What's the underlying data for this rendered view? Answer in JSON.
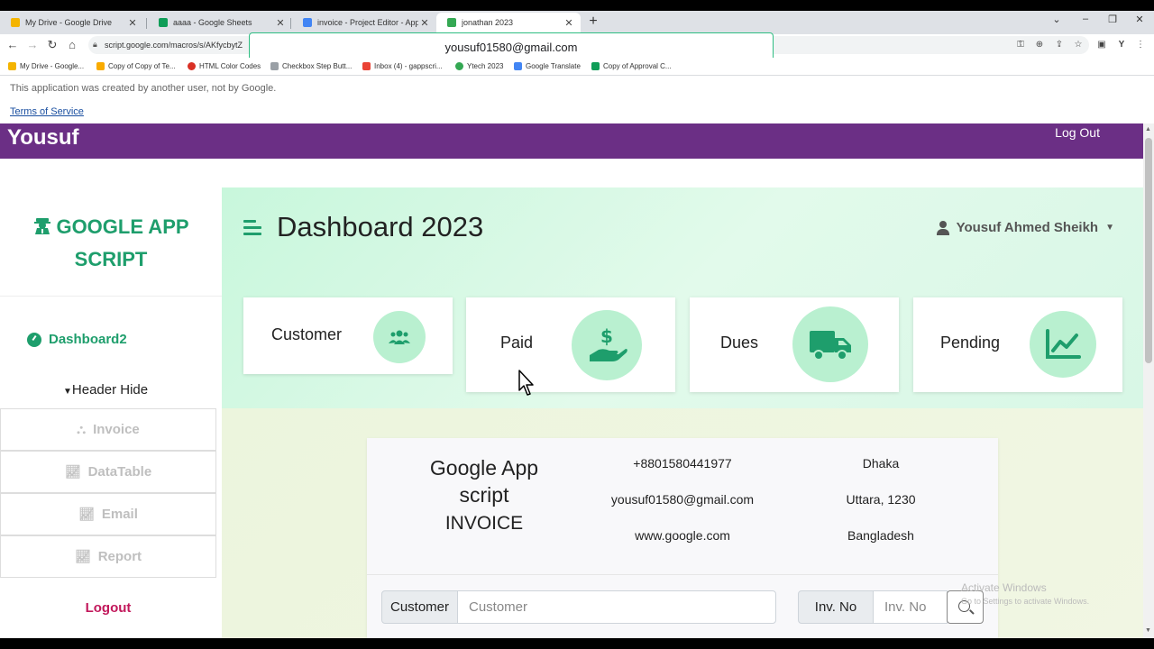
{
  "browser": {
    "tabs": [
      {
        "title": "My Drive - Google Drive",
        "favicon_color": "#f4b400"
      },
      {
        "title": "aaaa - Google Sheets",
        "favicon_color": "#0f9d58"
      },
      {
        "title": "invoice - Project Editor - Apps Sc",
        "favicon_color": "#4285f4"
      },
      {
        "title": "jonathan 2023",
        "favicon_color": "#34a853"
      }
    ],
    "url": "script.google.com/macros/s/AKfycbytZ",
    "autofill_suggestion": "yousuf01580@gmail.com",
    "bookmarks": [
      {
        "label": "My Drive - Google...",
        "color": "#f4b400"
      },
      {
        "label": "Copy of Copy of Te...",
        "color": "#f9ab00"
      },
      {
        "label": "HTML Color Codes",
        "color": "#d93025"
      },
      {
        "label": "Checkbox Step Butt...",
        "color": "#9aa0a6"
      },
      {
        "label": "Inbox (4) - gappscri...",
        "color": "#ea4335"
      },
      {
        "label": "Ytech 2023",
        "color": "#34a853"
      },
      {
        "label": "Google Translate",
        "color": "#4285f4"
      },
      {
        "label": "Copy of Approval C...",
        "color": "#0f9d58"
      }
    ]
  },
  "page": {
    "notice": "This application was created by another user, not by Google.",
    "terms": "Terms of Service"
  },
  "topbar": {
    "brand": "Yousuf",
    "logout": "Log Out"
  },
  "sidebar": {
    "logo": "GOOGLE APP SCRIPT",
    "dashboard": "Dashboard2",
    "header_hide": "Header Hide",
    "menu": [
      {
        "label": "Invoice",
        "icon": "share-nodes-icon"
      },
      {
        "label": "DataTable",
        "icon": "line-chart-icon"
      },
      {
        "label": "Email",
        "icon": "line-chart-icon"
      },
      {
        "label": "Report",
        "icon": "line-chart-icon"
      }
    ],
    "logout": "Logout"
  },
  "header": {
    "title": "Dashboard 2023",
    "user": "Yousuf Ahmed Sheikh"
  },
  "cards": [
    {
      "label": "Customer",
      "icon": "users-icon"
    },
    {
      "label": "Paid",
      "icon": "hand-dollar-icon"
    },
    {
      "label": "Dues",
      "icon": "truck-icon"
    },
    {
      "label": "Pending",
      "icon": "chart-line-icon"
    }
  ],
  "invoice": {
    "company_line1": "Google App",
    "company_line2": "script",
    "title": "INVOICE",
    "contact": [
      "+8801580441977",
      "yousuf01580@gmail.com",
      "www.google.com"
    ],
    "address": [
      "Dhaka",
      "Uttara, 1230",
      "Bangladesh"
    ],
    "customer_label": "Customer",
    "customer_placeholder": "Customer",
    "inv_label": "Inv. No",
    "inv_placeholder": "Inv. No"
  },
  "watermark": {
    "title": "Activate Windows",
    "subtitle": "Go to Settings to activate Windows."
  },
  "colors": {
    "brand_purple": "#6b2f85",
    "accent_green": "#1e9e6c",
    "logout_red": "#c2185b"
  }
}
